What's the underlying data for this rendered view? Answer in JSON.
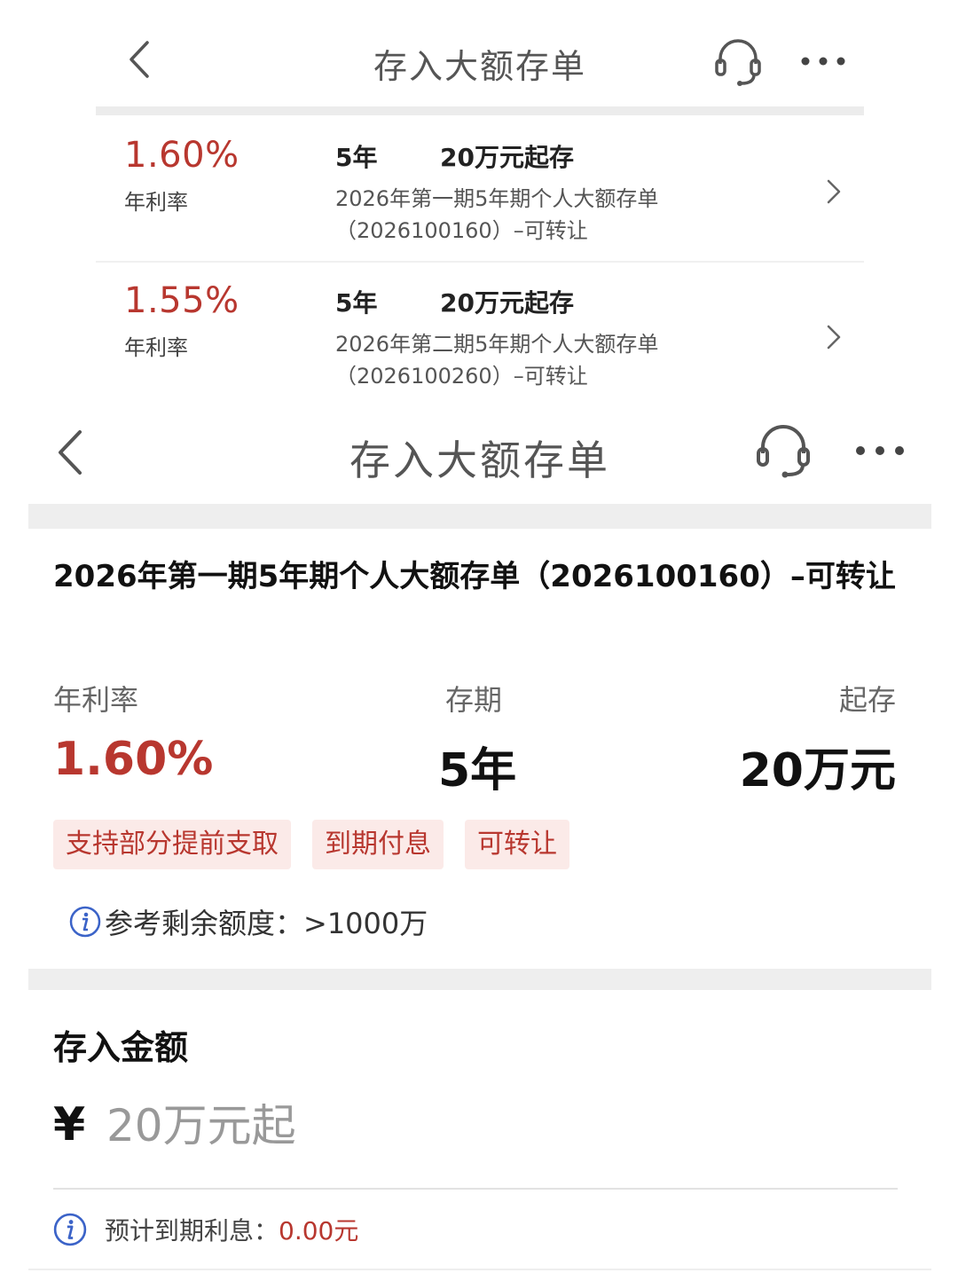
{
  "list_header": {
    "title": "存入大额存单",
    "back_icon": "chevron-left-icon",
    "service_icon": "headset-icon",
    "more_icon": "more-dots-icon"
  },
  "products": [
    {
      "rate": "1.60%",
      "rate_label": "年利率",
      "term": "5年",
      "minimum": "20万元起存",
      "name_line1": "2026年第一期5年期个人大额存单",
      "name_line2": "（2026100160）–可转让"
    },
    {
      "rate": "1.55%",
      "rate_label": "年利率",
      "term": "5年",
      "minimum": "20万元起存",
      "name_line1": "2026年第二期5年期个人大额存单",
      "name_line2": "（2026100260）–可转让"
    }
  ],
  "detail_header": {
    "title": "存入大额存单",
    "back_icon": "chevron-left-icon",
    "service_icon": "headset-icon",
    "more_icon": "more-dots-icon"
  },
  "detail": {
    "product_title": "2026年第一期5年期个人大额存单（2026100160）–可转让",
    "rate_label": "年利率",
    "rate_value": "1.60%",
    "term_label": "存期",
    "term_value": "5年",
    "min_label": "起存",
    "min_value": "20万元",
    "tags": [
      "支持部分提前支取",
      "到期付息",
      "可转让"
    ],
    "quota_text": "参考剩余额度：>1000万"
  },
  "deposit": {
    "label": "存入金额",
    "currency": "¥",
    "placeholder": "20万元起",
    "expected_label": "预计到期利息：",
    "expected_value": "0.00元"
  },
  "colors": {
    "accent_red": "#b8372f",
    "tag_bg": "#fbeae8",
    "info_blue": "#3b63c8",
    "gray_bar": "#eeeeee"
  }
}
